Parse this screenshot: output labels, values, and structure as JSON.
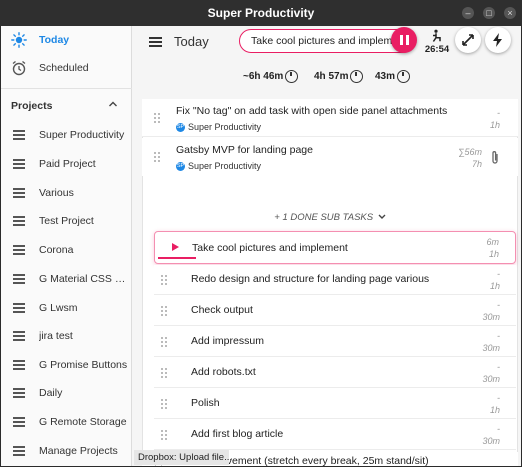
{
  "window": {
    "title": "Super Productivity"
  },
  "sidebar": {
    "items": [
      {
        "label": "Today",
        "icon": "sun-icon",
        "active": true
      },
      {
        "label": "Scheduled",
        "icon": "alarm-clock-icon",
        "active": false
      }
    ],
    "projects_heading": "Projects",
    "projects": [
      "Super Productivity",
      "Paid Project",
      "Various",
      "Test Project",
      "Corona",
      "G Material CSS Va...",
      "G Lwsm",
      "jira test",
      "G Promise Buttons",
      "Daily",
      "G Remote Storage",
      "Manage Projects"
    ]
  },
  "header": {
    "title": "Today",
    "current_task": "Take cool pictures and implement",
    "timer": "26:54",
    "accent_color": "#e91e63"
  },
  "stats": {
    "estimate": "~6h 46m",
    "worked": "4h 57m",
    "break": "43m"
  },
  "tasks": [
    {
      "title": "Fix \"No tag\" on add task with open side panel attachments",
      "project": "Super Productivity",
      "time_top": "-",
      "time_bottom": "1h"
    },
    {
      "title": "Gatsby MVP for landing page",
      "project": "Super Productivity",
      "time_top": "∑56m",
      "time_bottom": "7h"
    }
  ],
  "done_subtasks_label": "+ 1 DONE SUB TASKS",
  "subtasks": [
    {
      "title": "Take cool pictures and implement",
      "time_top": "6m",
      "time_bottom": "1h",
      "current": true
    },
    {
      "title": "Redo design and structure for landing page various",
      "time_top": "-",
      "time_bottom": "1h"
    },
    {
      "title": "Check output",
      "time_top": "-",
      "time_bottom": "30m"
    },
    {
      "title": "Add impressum",
      "time_top": "-",
      "time_bottom": "30m"
    },
    {
      "title": "Add robots.txt",
      "time_top": "-",
      "time_bottom": "30m"
    },
    {
      "title": "Polish",
      "time_top": "-",
      "time_bottom": "1h"
    },
    {
      "title": "Add first blog article",
      "time_top": "-",
      "time_bottom": "30m"
    }
  ],
  "last_task": {
    "title": "Perfect movement (stretch every break, 25m stand/sit)"
  },
  "snackbar": "Dropbox: Upload file..."
}
